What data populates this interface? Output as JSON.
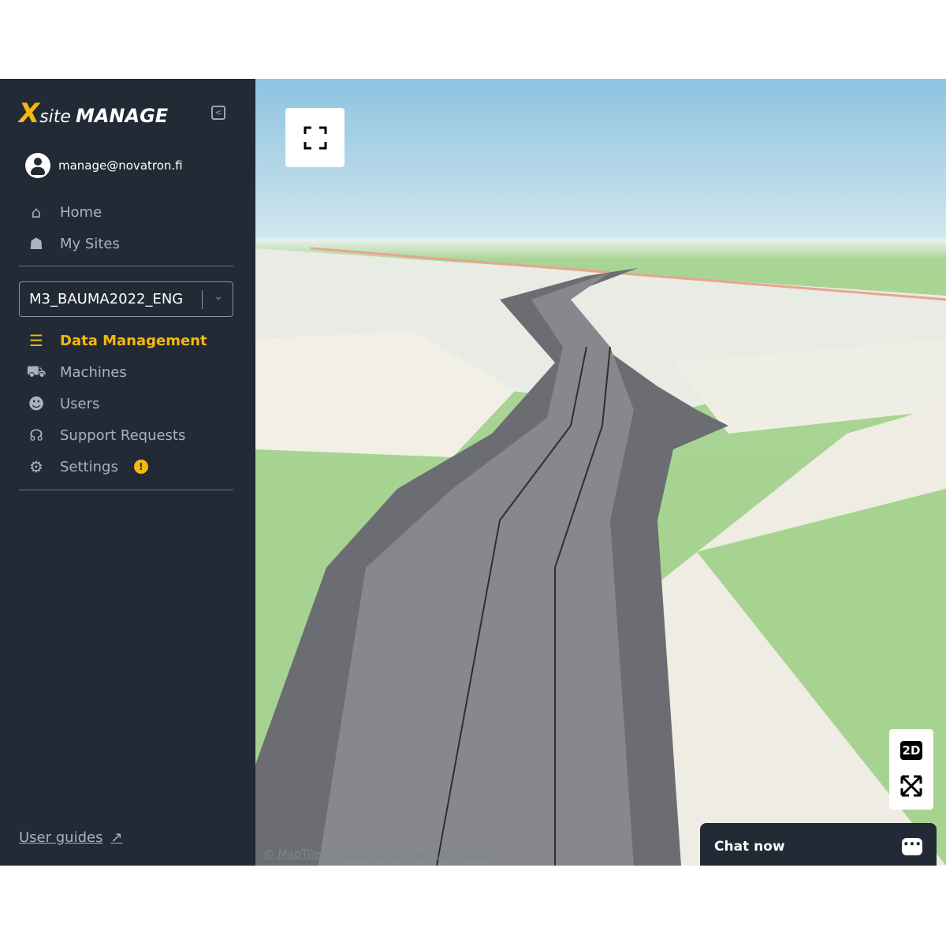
{
  "brand": {
    "logo_x": "X",
    "logo_site": "site",
    "logo_manage": "MANAGE",
    "accent": "#f5b80c"
  },
  "user": {
    "email": "manage@novatron.fi"
  },
  "top_nav": [
    {
      "label": "Home",
      "icon": "home-icon"
    },
    {
      "label": "My Sites",
      "icon": "worker-icon"
    }
  ],
  "site_select": {
    "value": "M3_BAUMA2022_ENG"
  },
  "site_nav": [
    {
      "label": "Data Management",
      "icon": "database-icon",
      "active": true
    },
    {
      "label": "Machines",
      "icon": "excavator-icon"
    },
    {
      "label": "Users",
      "icon": "users-icon"
    },
    {
      "label": "Support Requests",
      "icon": "headset-icon"
    },
    {
      "label": "Settings",
      "icon": "gears-icon",
      "badge": "!"
    }
  ],
  "footer": {
    "user_guides": "User guides"
  },
  "map": {
    "attribution_maptiler": "© MapTiler",
    "attribution_osm": "© OpenStreetMap contributors",
    "mode_button": "2D"
  },
  "chat": {
    "label": "Chat now",
    "bubble": "•••"
  }
}
